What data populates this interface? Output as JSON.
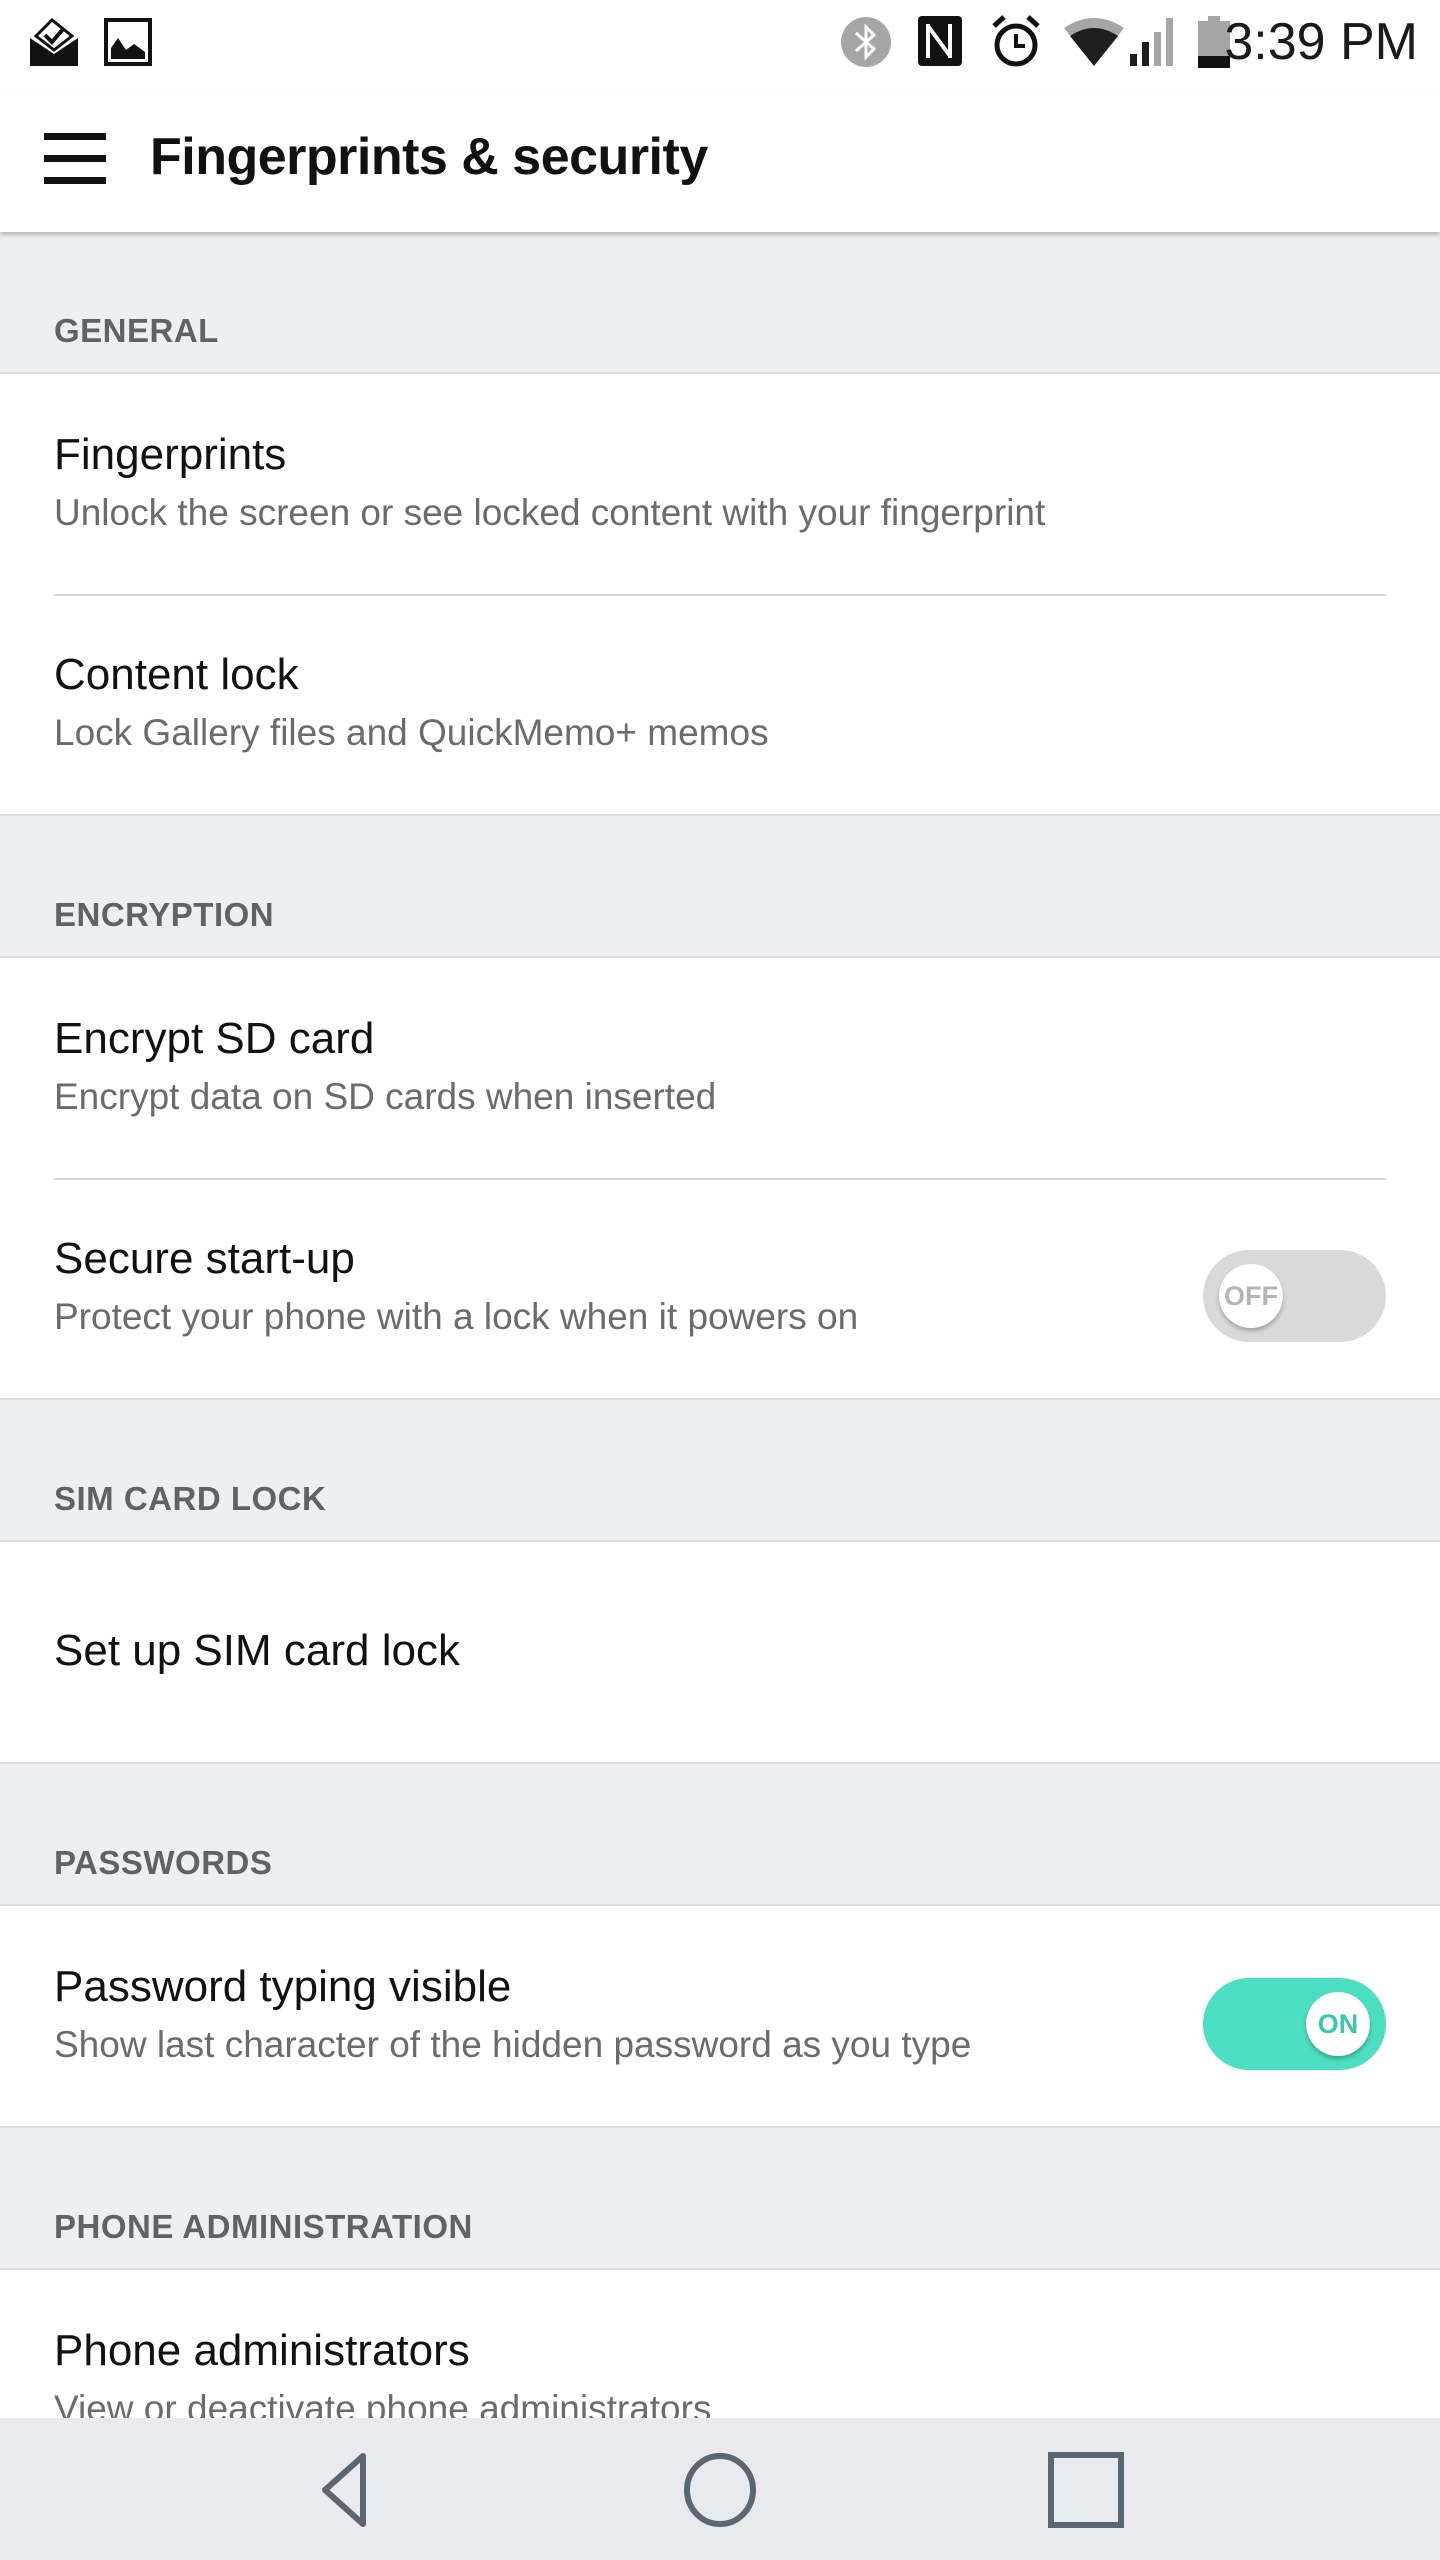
{
  "status_bar": {
    "left_icons": [
      "mail-check-icon",
      "gallery-icon"
    ],
    "right_icons": [
      "bluetooth-icon",
      "nfc-icon",
      "alarm-icon",
      "wifi-icon",
      "signal-icon",
      "battery-icon"
    ],
    "time": "3:39 PM"
  },
  "app_bar": {
    "menu_icon": "hamburger-menu-icon",
    "title": "Fingerprints & security"
  },
  "sections": [
    {
      "header": "GENERAL",
      "items": [
        {
          "title": "Fingerprints",
          "subtitle": "Unlock the screen or see locked content with your fingerprint"
        },
        {
          "title": "Content lock",
          "subtitle": "Lock Gallery files and QuickMemo+ memos"
        }
      ]
    },
    {
      "header": "ENCRYPTION",
      "items": [
        {
          "title": "Encrypt SD card",
          "subtitle": "Encrypt data on SD cards when inserted"
        },
        {
          "title": "Secure start-up",
          "subtitle": "Protect your phone with a lock when it powers on",
          "toggle": {
            "state": "off",
            "label": "OFF"
          }
        }
      ]
    },
    {
      "header": "SIM CARD LOCK",
      "items": [
        {
          "title": "Set up SIM card lock"
        }
      ]
    },
    {
      "header": "PASSWORDS",
      "items": [
        {
          "title": "Password typing visible",
          "subtitle": "Show last character of the hidden password as you type",
          "toggle": {
            "state": "on",
            "label": "ON"
          }
        }
      ]
    },
    {
      "header": "PHONE ADMINISTRATION",
      "items": [
        {
          "title": "Phone administrators",
          "subtitle": "View or deactivate phone administrators"
        }
      ]
    }
  ],
  "nav_bar": {
    "buttons": [
      "back-icon",
      "home-icon",
      "recents-icon"
    ]
  },
  "colors": {
    "accent": "#4cdec0",
    "toggle_off": "#d9d9d9",
    "section_bg": "#eeeff3",
    "section_label": "#5f6368"
  }
}
